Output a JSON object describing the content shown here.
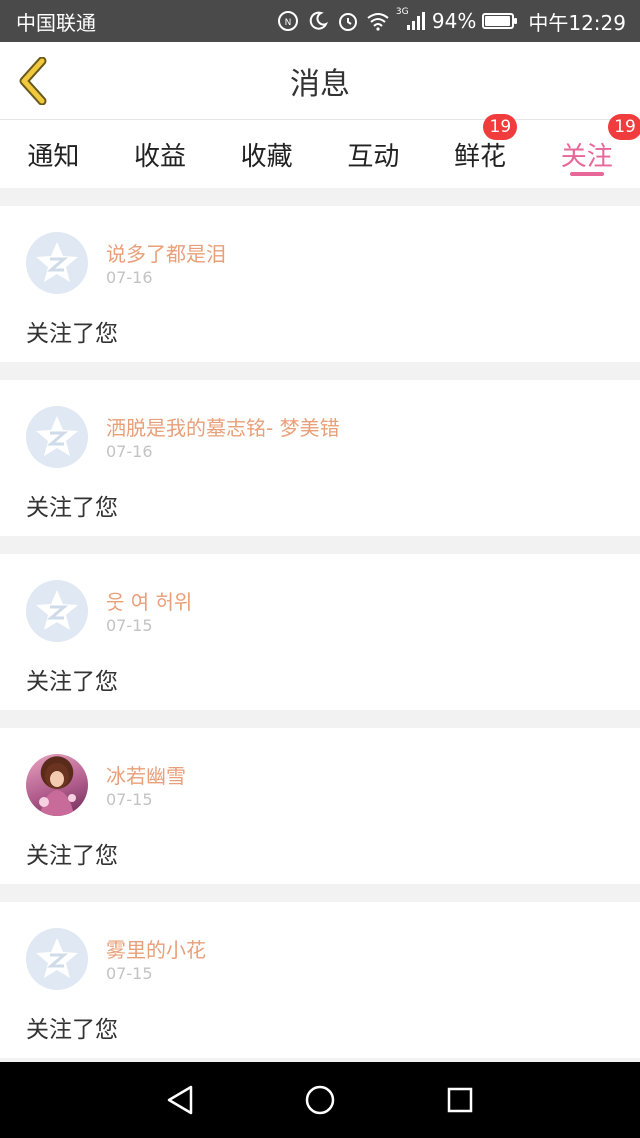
{
  "status_bar": {
    "carrier": "中国联通",
    "network_type": "3G",
    "battery_percent": "94%",
    "battery_level": 0.94,
    "time": "中午12:29"
  },
  "header": {
    "title": "消息",
    "back_icon": "chevron-left-icon"
  },
  "tabs": [
    {
      "label": "通知",
      "badge": ""
    },
    {
      "label": "收益",
      "badge": ""
    },
    {
      "label": "收藏",
      "badge": ""
    },
    {
      "label": "互动",
      "badge": ""
    },
    {
      "label": "鲜花",
      "badge": "19"
    },
    {
      "label": "关注",
      "badge": "19",
      "active": true
    }
  ],
  "items": [
    {
      "name": "说多了都是泪",
      "date": "07-16",
      "message": "关注了您",
      "avatar": "default"
    },
    {
      "name": "洒脱是我的墓志铭- 梦美错",
      "date": "07-16",
      "message": "关注了您",
      "avatar": "default"
    },
    {
      "name": "웃 여 허위",
      "date": "07-15",
      "message": "关注了您",
      "avatar": "default"
    },
    {
      "name": "冰若幽雪",
      "date": "07-15",
      "message": "关注了您",
      "avatar": "photo"
    },
    {
      "name": "雾里的小花",
      "date": "07-15",
      "message": "关注了您",
      "avatar": "default"
    }
  ],
  "colors": {
    "accent": "#e8679a",
    "badge": "#f03c3c",
    "name": "#e8a07a",
    "back_icon": "#e8c23a"
  }
}
